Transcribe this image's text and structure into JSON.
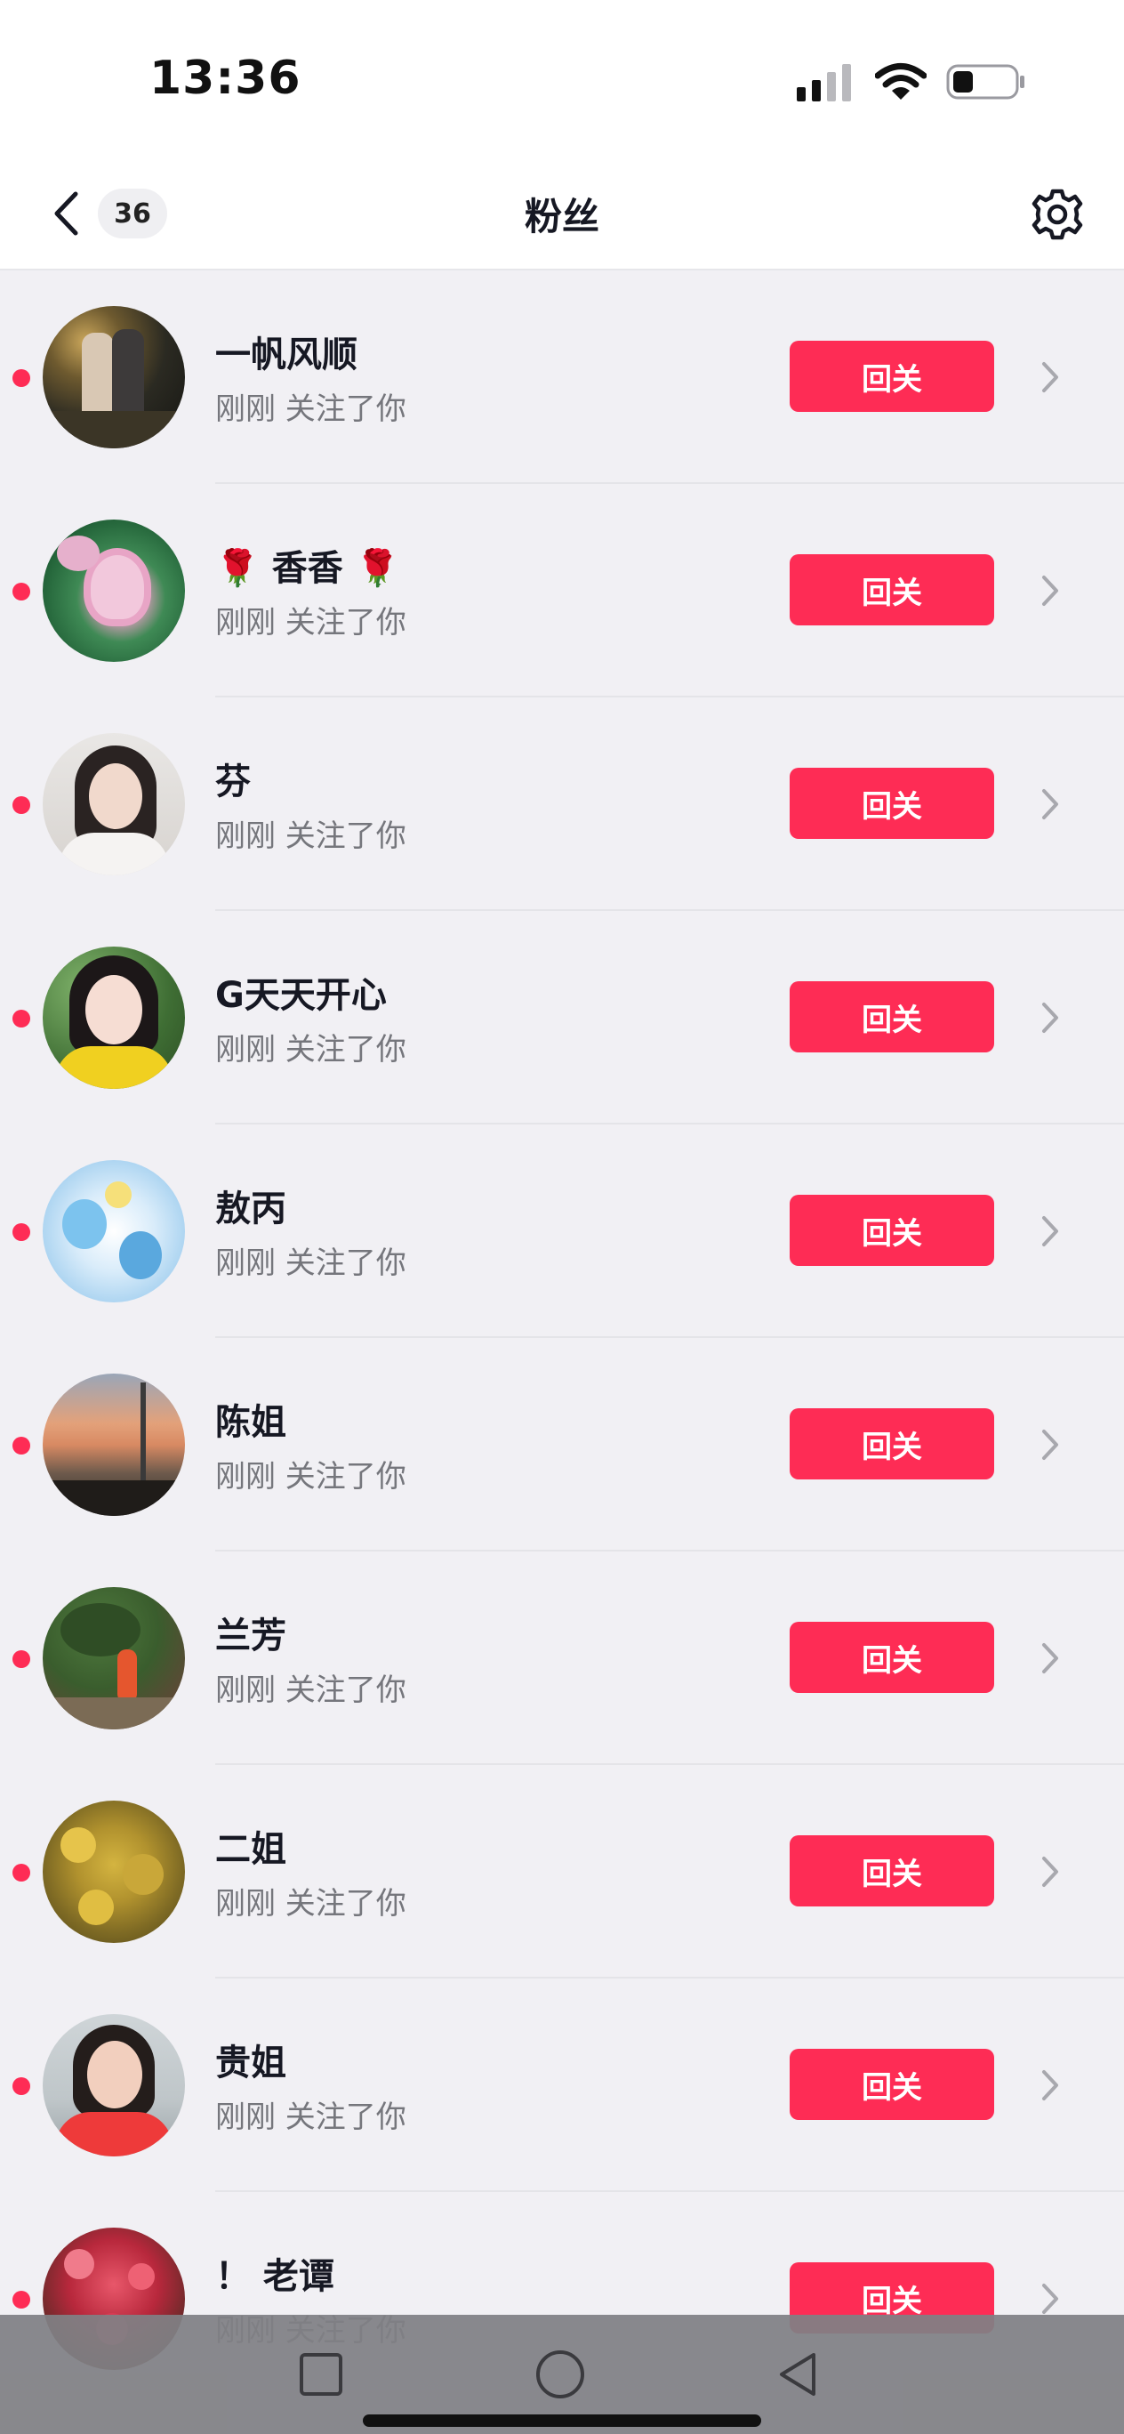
{
  "status_bar": {
    "time": "13:36",
    "icons": [
      "cellular-signal-icon",
      "wifi-icon",
      "battery-icon"
    ]
  },
  "nav": {
    "back_icon": "chevron-left-icon",
    "badge_count": "36",
    "title": "粉丝",
    "settings_icon": "gear-icon"
  },
  "followers": [
    {
      "name": "一帆风顺",
      "subtitle": "刚刚 关注了你",
      "button": "回关"
    },
    {
      "name": "香香",
      "subtitle": "刚刚 关注了你",
      "button": "回关"
    },
    {
      "name": "芬",
      "subtitle": "刚刚 关注了你",
      "button": "回关"
    },
    {
      "name": "G天天开心",
      "subtitle": "刚刚 关注了你",
      "button": "回关"
    },
    {
      "name": "敖丙",
      "subtitle": "刚刚 关注了你",
      "button": "回关"
    },
    {
      "name": "陈姐",
      "subtitle": "刚刚 关注了你",
      "button": "回关"
    },
    {
      "name": "兰芳",
      "subtitle": "刚刚 关注了你",
      "button": "回关"
    },
    {
      "name": "二姐",
      "subtitle": "刚刚 关注了你",
      "button": "回关"
    },
    {
      "name": "贵姐",
      "subtitle": "刚刚 关注了你",
      "button": "回关"
    },
    {
      "name": "！ 老谭",
      "subtitle": "刚刚 关注了你",
      "button": "回关"
    }
  ],
  "decorations": {
    "rose_emoji": "🌹"
  },
  "colors": {
    "accent": "#fe2c55",
    "page_background": "#f1f0f4",
    "header_background": "#ffffff",
    "primary_text": "#161823",
    "secondary_text": "#75767c"
  },
  "system_nav": {
    "icons": [
      "recent-apps-square-icon",
      "home-circle-icon",
      "back-triangle-icon"
    ]
  }
}
